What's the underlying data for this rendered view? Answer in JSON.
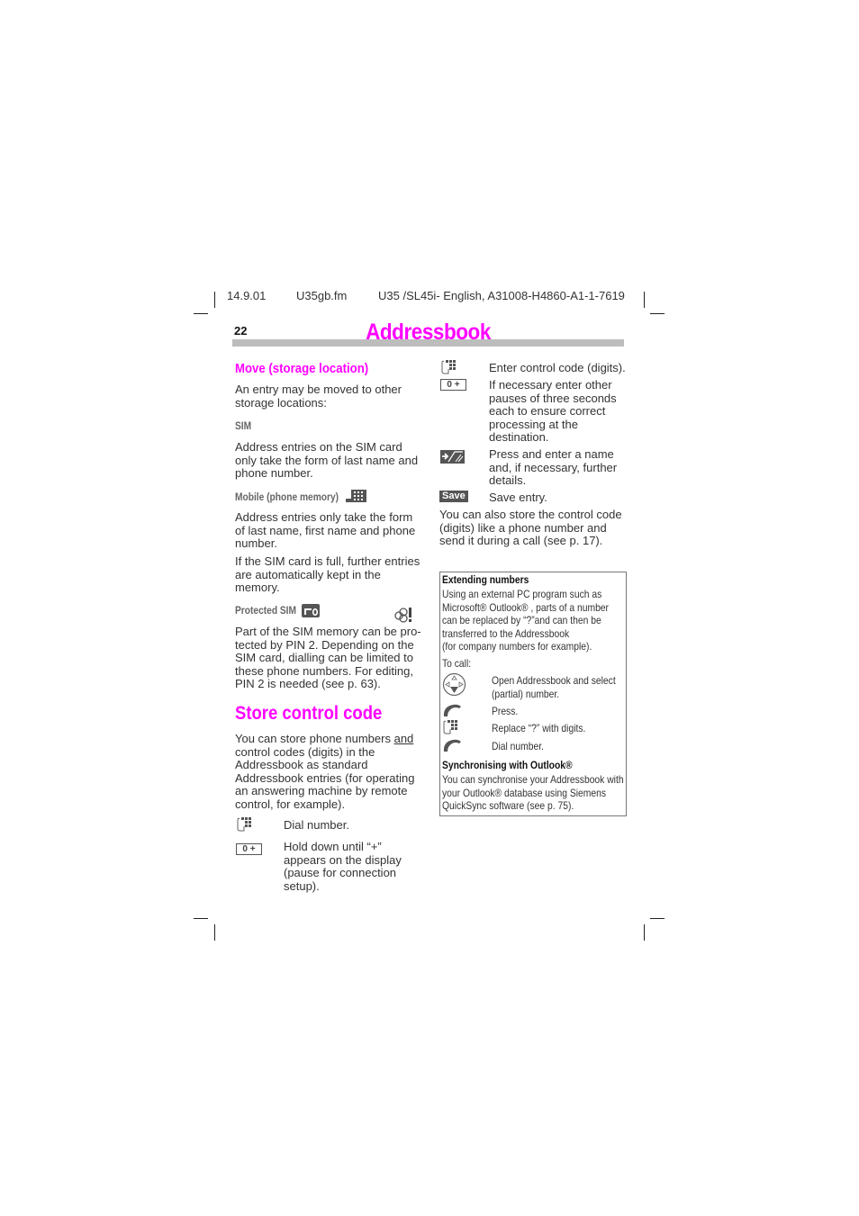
{
  "header": {
    "date": "14.9.01",
    "file": "U35gb.fm",
    "doc": "U35 /SL45i- English, A31008-H4860-A1-1-7619"
  },
  "page": {
    "number": "22",
    "title": "Addressbook",
    "accent_color": "#ff00ff",
    "bar_color": "#bdbdbd"
  },
  "left": {
    "move": {
      "heading": "Move (storage location)",
      "intro": [
        "An entry may be moved to other",
        "storage locations:"
      ],
      "sim_label": "SIM",
      "sim_text": [
        "Address entries on the SIM card",
        "only take the form of last name and",
        "phone number."
      ],
      "mobile_label": "Mobile (phone memory)",
      "mobile_text": [
        "Address entries only take the form",
        "of last name, first name and phone",
        "number."
      ],
      "full_text": [
        "If the SIM card is full, further entries",
        "are automatically kept in the",
        "memory."
      ],
      "protected_label": "Protected SIM",
      "protected_text": [
        "Part of the SIM memory can be pro-",
        "tected by PIN 2. Depending on the",
        "SIM card, dialling can be limited to",
        "these phone numbers. For editing,",
        "PIN 2 is needed (see p. 63)."
      ]
    },
    "store": {
      "heading": "Store control code",
      "intro_pre": "You can store phone numbers ",
      "intro_underlined": "and",
      "intro_rest": [
        "control codes (digits) in the",
        "Addressbook as standard",
        "Addressbook entries (for operating",
        "an answering machine by remote",
        "control, for example)."
      ],
      "steps": [
        {
          "icon": "keypad-icon",
          "text": [
            "Dial number."
          ]
        },
        {
          "icon": "key-zero-plus-icon",
          "key_label": "0 +",
          "text": [
            "Hold down until “+”",
            "appears on the display",
            "(pause for connection",
            "setup)."
          ]
        }
      ]
    }
  },
  "right": {
    "steps": [
      {
        "icon": "keypad-icon",
        "text": [
          "Enter control code (digits)."
        ]
      },
      {
        "icon": "key-zero-plus-icon",
        "key_label": "0 +",
        "text": [
          "If necessary enter other",
          "pauses of three seconds",
          "each to ensure correct",
          "processing at the",
          "destination."
        ]
      },
      {
        "icon": "softkey-new-entry-icon",
        "text": [
          "Press and enter a name",
          "and, if necessary, further",
          "details."
        ]
      },
      {
        "icon": "save-softkey",
        "key_label": "Save",
        "text": [
          "Save entry."
        ]
      }
    ],
    "note": [
      "You can also store the control code",
      "(digits) like a phone number and",
      "send it during a call (see p. 17)."
    ],
    "box": {
      "ext_heading": "Extending numbers",
      "ext_text": [
        "Using an external PC program such as",
        "Microsoft® Outlook® , parts of a number",
        "can be replaced by “?”and can then be",
        "transferred to the Addressbook",
        "(for company numbers for example)."
      ],
      "to_call": "To call:",
      "steps": [
        {
          "icon": "navigation-key-icon",
          "text": [
            "Open Addressbook and select",
            "(partial) number."
          ]
        },
        {
          "icon": "call-key-icon",
          "text": [
            "Press."
          ]
        },
        {
          "icon": "keypad-icon",
          "text": [
            "Replace “?” with digits."
          ]
        },
        {
          "icon": "call-key-icon",
          "text": [
            "Dial number."
          ]
        }
      ],
      "sync_heading": "Synchronising with Outlook®",
      "sync_text": [
        "You can synchronise your Addressbook with",
        "your Outlook® database using Siemens",
        "QuickSync software (see p. 75)."
      ]
    }
  }
}
